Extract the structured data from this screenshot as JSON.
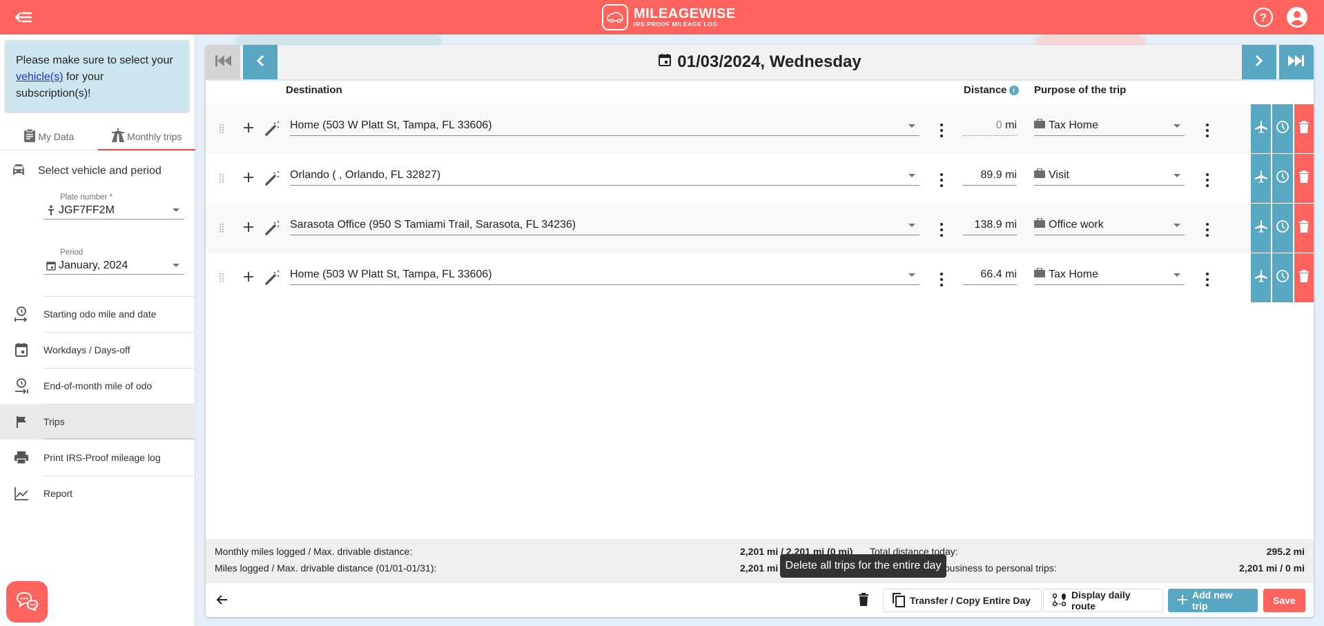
{
  "header": {
    "logo_title": "MILEAGEWISE",
    "logo_subtitle": "IRS-PROOF MILEAGE LOG",
    "icons": [
      "menu-collapse-icon",
      "help-icon",
      "account-icon"
    ]
  },
  "sidebar": {
    "notice": {
      "before": "Please make sure to select your ",
      "link": "vehicle(s)",
      "after": " for your subscription(s)!"
    },
    "tabs": [
      {
        "label": "My Data",
        "icon": "clipboard-icon",
        "active": false
      },
      {
        "label": "Monthly trips",
        "icon": "road-icon",
        "active": true
      }
    ],
    "section_title": "Select vehicle and period",
    "plate": {
      "label": "Plate number *",
      "value": "JGF7FF2M"
    },
    "period": {
      "label": "Period",
      "value": "January, 2024"
    },
    "nav": [
      {
        "label": "Starting odo mile and date",
        "icon": "odo-start-icon"
      },
      {
        "label": "Workdays / Days-off",
        "icon": "calendar-icon"
      },
      {
        "label": "End-of-month mile of odo",
        "icon": "odo-end-icon"
      },
      {
        "label": "Trips",
        "icon": "flag-icon",
        "active": true
      },
      {
        "label": "Print IRS-Proof mileage log",
        "icon": "print-icon"
      },
      {
        "label": "Report",
        "icon": "chart-line-icon"
      }
    ]
  },
  "main": {
    "date": "01/03/2024, Wednesday",
    "columns": {
      "destination": "Destination",
      "distance": "Distance",
      "purpose": "Purpose of the trip"
    },
    "trips": [
      {
        "destination": "Home (503 W Platt St, Tampa, FL 33606)",
        "distance": "0",
        "unit": "mi",
        "purpose": "Tax Home"
      },
      {
        "destination": "Orlando ( , Orlando, FL 32827)",
        "distance": "89.9",
        "unit": "mi",
        "purpose": "Visit"
      },
      {
        "destination": "Sarasota Office (950 S Tamiami Trail, Sarasota, FL 34236)",
        "distance": "138.9",
        "unit": "mi",
        "purpose": "Office work"
      },
      {
        "destination": "Home (503 W Platt St, Tampa, FL 33606)",
        "distance": "66.4",
        "unit": "mi",
        "purpose": "Tax Home"
      }
    ],
    "summary": {
      "monthly_label": "Monthly miles logged / Max. drivable distance:",
      "monthly_value": "2,201 mi / 2,201 mi (0 mi)",
      "period_label": "Miles logged / Max. drivable distance (01/01-01/31):",
      "period_value": "2,201 mi",
      "total_today_label": "Total distance today:",
      "total_today_value": "295.2 mi",
      "ratio_label_visible": "business to personal trips:",
      "ratio_value": "2,201 mi / 0 mi"
    },
    "footer": {
      "transfer_label": "Transfer / Copy Entire Day",
      "route_label": "Display daily route",
      "add_label": "Add new trip",
      "save_label": "Save"
    },
    "tooltip": "Delete all trips for the entire day"
  },
  "colors": {
    "brand_red": "#ff635e",
    "accent_blue": "#58a8c4"
  }
}
